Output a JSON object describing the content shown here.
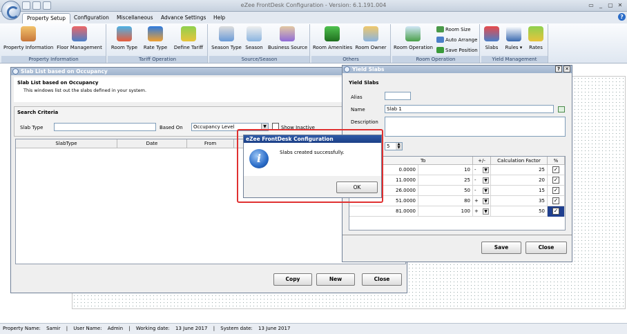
{
  "app": {
    "title": "eZee FrontDesk Configuration - Version: 6.1.191.004",
    "menu_tabs": [
      "Property Setup",
      "Configuration",
      "Miscellaneous",
      "Advance Settings",
      "Help"
    ]
  },
  "ribbon": {
    "property_information_group": {
      "label": "Property Information",
      "buttons": [
        "Property Information",
        "Floor Management"
      ]
    },
    "tariff_group": {
      "label": "Tariff Operation",
      "buttons": [
        "Room Type",
        "Rate Type",
        "Define Tariff"
      ]
    },
    "season_group": {
      "label": "Source/Season",
      "buttons": [
        "Season Type",
        "Season",
        "Business Source"
      ]
    },
    "others_group": {
      "label": "Others",
      "buttons": [
        "Room Amenities",
        "Room Owner"
      ]
    },
    "room_operation_group": {
      "label": "Room Operation",
      "buttons": [
        "Room Operation"
      ],
      "small_buttons": [
        "Room Size",
        "Auto Arrange",
        "Save Position"
      ]
    },
    "yield_group": {
      "label": "Yield Management",
      "buttons": [
        "Slabs",
        "Rules",
        "Rates"
      ]
    }
  },
  "slab_list": {
    "window_title": "Slab List based on Occupancy",
    "heading": "Slab List based on Occupancy",
    "description": "This windows list out the slabs defined in your system.",
    "search_criteria_label": "Search Criteria",
    "slab_type_label": "Slab Type",
    "slab_type_value": "",
    "based_on_label": "Based On",
    "based_on_value": "Occupancy Level",
    "show_inactive_label": "Show Inactive",
    "columns": [
      "SlabType",
      "Date",
      "From"
    ],
    "buttons": {
      "copy": "Copy",
      "new": "New",
      "close": "Close"
    }
  },
  "yield_slabs": {
    "window_title": "Yield Slabs",
    "heading": "Yield Slabs",
    "alias_label": "Alias",
    "alias_value": "",
    "name_label": "Name",
    "name_value": "Slab 1",
    "description_label": "Description",
    "description_value": "",
    "slab_count_value": "5",
    "columns": [
      "To",
      "+/-",
      "Calculation Factor",
      "%"
    ],
    "rows": [
      {
        "from": "0.0000",
        "to": "10",
        "sign": "-",
        "factor": "25"
      },
      {
        "from": "11.0000",
        "to": "25",
        "sign": "-",
        "factor": "20"
      },
      {
        "from": "26.0000",
        "to": "50",
        "sign": "-",
        "factor": "15"
      },
      {
        "from": "51.0000",
        "to": "80",
        "sign": "+",
        "factor": "35"
      },
      {
        "from": "81.0000",
        "to": "100",
        "sign": "+",
        "factor": "50"
      }
    ],
    "buttons": {
      "save": "Save",
      "close": "Close"
    }
  },
  "dialog": {
    "title": "eZee FrontDesk Configuration",
    "message": "Slabs created successfully.",
    "ok_label": "OK",
    "icon": "info-icon"
  },
  "status_bar": {
    "property_name_label": "Property Name:",
    "property_name": "Samir",
    "user_name_label": "User Name:",
    "user_name": "Admin",
    "working_date_label": "Working date:",
    "working_date": "13 June 2017",
    "system_date_label": "System date:",
    "system_date": "13 June 2017"
  },
  "colors": {
    "accent": "#9fb3cd",
    "dialog_highlight": "#e03030",
    "info": "#2a6cc8"
  }
}
